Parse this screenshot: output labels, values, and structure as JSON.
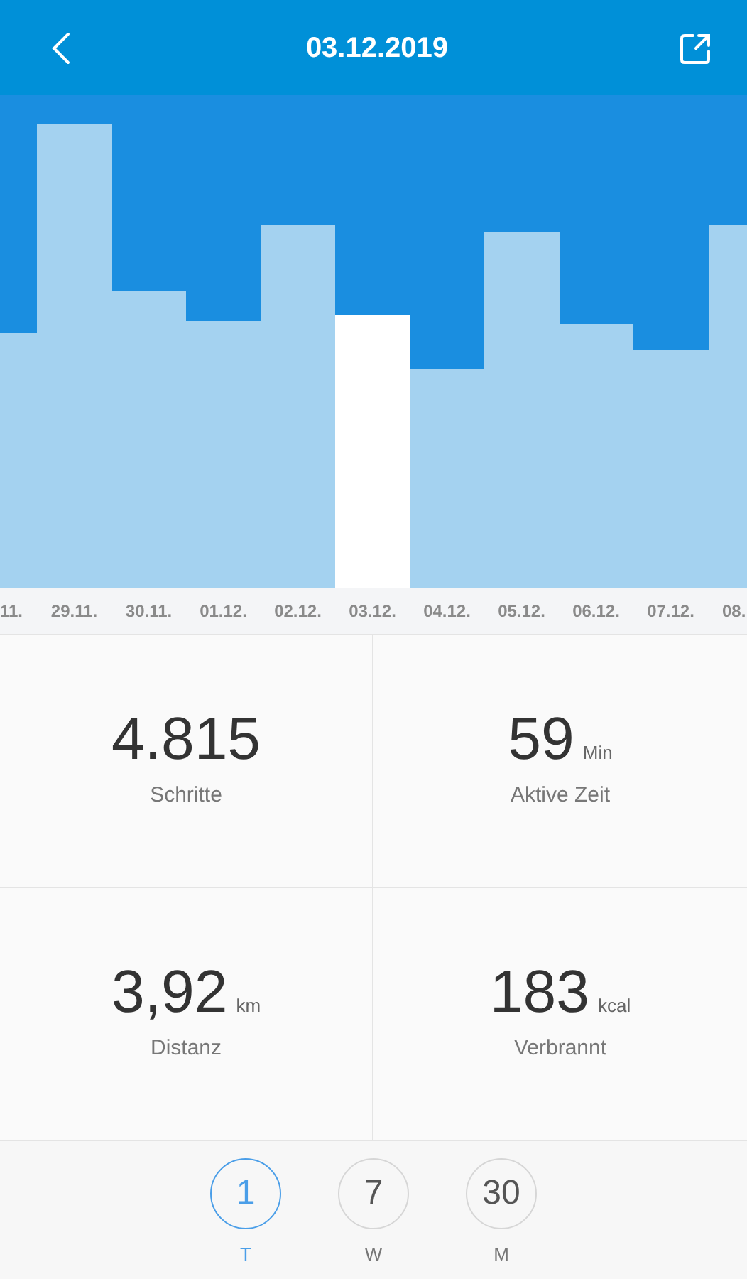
{
  "header": {
    "title": "03.12.2019"
  },
  "days": [
    {
      "label": "11.",
      "selected": false
    },
    {
      "label": "29.11.",
      "selected": false
    },
    {
      "label": "30.11.",
      "selected": false
    },
    {
      "label": "01.12.",
      "selected": false
    },
    {
      "label": "02.12.",
      "selected": false
    },
    {
      "label": "03.12.",
      "selected": true
    },
    {
      "label": "04.12.",
      "selected": false
    },
    {
      "label": "05.12.",
      "selected": false
    },
    {
      "label": "06.12.",
      "selected": false
    },
    {
      "label": "07.12.",
      "selected": false
    },
    {
      "label": "08.",
      "selected": false
    }
  ],
  "stats": [
    {
      "value": "4.815",
      "label": "Schritte"
    },
    {
      "value": "59",
      "unit": "Min",
      "label": "Aktive Zeit"
    },
    {
      "value": "3,92",
      "unit": "km",
      "label": "Distanz"
    },
    {
      "value": "183",
      "unit": "kcal",
      "label": "Verbrannt"
    }
  ],
  "ranges": [
    {
      "number": "1",
      "label": "T",
      "selected": true
    },
    {
      "number": "7",
      "label": "W",
      "selected": false
    },
    {
      "number": "30",
      "label": "M",
      "selected": false
    }
  ]
}
